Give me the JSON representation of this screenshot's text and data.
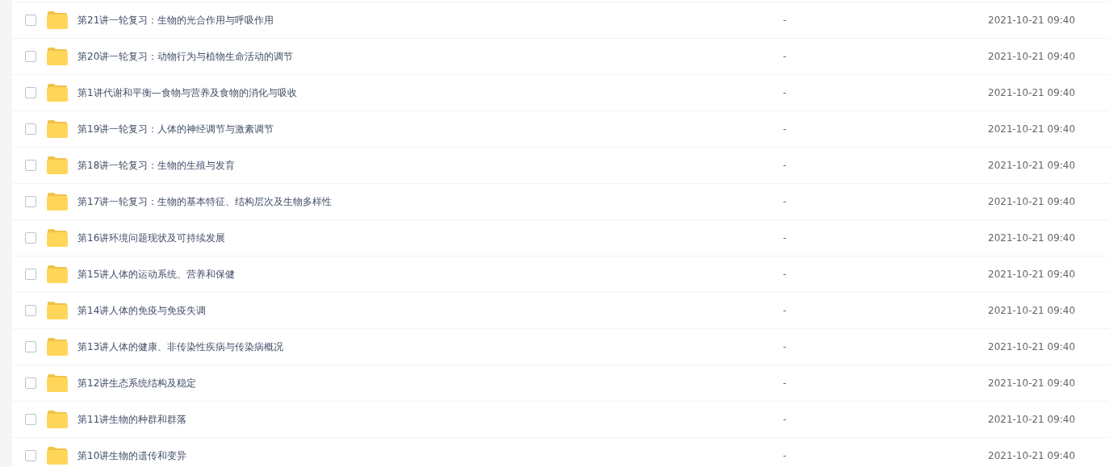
{
  "files": [
    {
      "name": "第21讲一轮复习：生物的光合作用与呼吸作用",
      "size": "-",
      "modified": "2021-10-21 09:40",
      "checked": false
    },
    {
      "name": "第20讲一轮复习：动物行为与植物生命活动的调节",
      "size": "-",
      "modified": "2021-10-21 09:40",
      "checked": false
    },
    {
      "name": "第1讲代谢和平衡—食物与营养及食物的消化与吸收",
      "size": "-",
      "modified": "2021-10-21 09:40",
      "checked": false
    },
    {
      "name": "第19讲一轮复习：人体的神经调节与激素调节",
      "size": "-",
      "modified": "2021-10-21 09:40",
      "checked": false
    },
    {
      "name": "第18讲一轮复习：生物的生殖与发育",
      "size": "-",
      "modified": "2021-10-21 09:40",
      "checked": false
    },
    {
      "name": "第17讲一轮复习：生物的基本特征、结构层次及生物多样性",
      "size": "-",
      "modified": "2021-10-21 09:40",
      "checked": false
    },
    {
      "name": "第16讲环境问题现状及可持续发展",
      "size": "-",
      "modified": "2021-10-21 09:40",
      "checked": false
    },
    {
      "name": "第15讲人体的运动系统、营养和保健",
      "size": "-",
      "modified": "2021-10-21 09:40",
      "checked": false
    },
    {
      "name": "第14讲人体的免疫与免疫失调",
      "size": "-",
      "modified": "2021-10-21 09:40",
      "checked": false
    },
    {
      "name": "第13讲人体的健康、非传染性疾病与传染病概况",
      "size": "-",
      "modified": "2021-10-21 09:40",
      "checked": false
    },
    {
      "name": "第12讲生态系统结构及稳定",
      "size": "-",
      "modified": "2021-10-21 09:40",
      "checked": false
    },
    {
      "name": "第11讲生物的种群和群落",
      "size": "-",
      "modified": "2021-10-21 09:40",
      "checked": false
    },
    {
      "name": "第10讲生物的遗传和变异",
      "size": "-",
      "modified": "2021-10-21 09:40",
      "checked": false
    }
  ]
}
